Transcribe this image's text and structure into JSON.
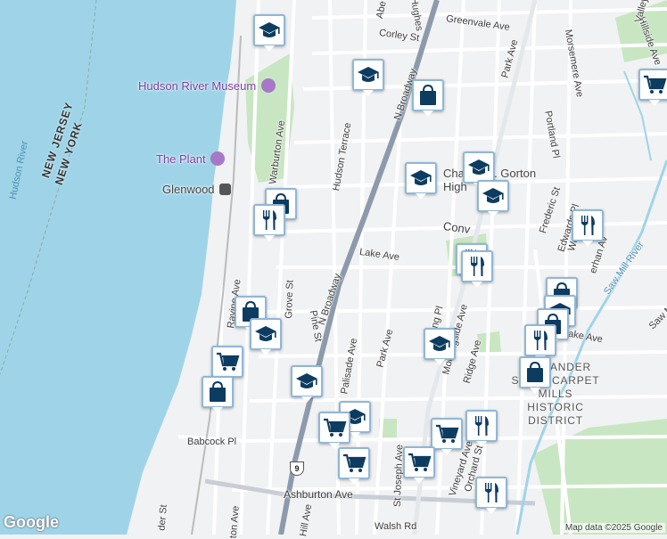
{
  "map": {
    "street_labels": [
      {
        "id": "greenvale-ave",
        "text": "Greenvale Ave"
      },
      {
        "id": "corley-st",
        "text": "Corley St"
      },
      {
        "id": "hughes",
        "text": "Hughes"
      },
      {
        "id": "n-broadway-top",
        "text": "N Broadway"
      },
      {
        "id": "n-broadway-mid",
        "text": "N Broadway"
      },
      {
        "id": "park-ave-top",
        "text": "Park Ave"
      },
      {
        "id": "park-ave-bottom",
        "text": "Park Ave"
      },
      {
        "id": "morsemere-ave",
        "text": "Morsemere Ave"
      },
      {
        "id": "portland-pl",
        "text": "Portland Pl"
      },
      {
        "id": "hudson-terrace",
        "text": "Hudson Terrace"
      },
      {
        "id": "warburton-ave",
        "text": "Warburton Ave"
      },
      {
        "id": "frederic-st",
        "text": "Frederic St"
      },
      {
        "id": "edwards-pl",
        "text": "Edwards Pl"
      },
      {
        "id": "lake-ave",
        "text": "Lake Ave"
      },
      {
        "id": "lake-ave-east",
        "text": "ake Ave"
      },
      {
        "id": "convent",
        "text": "Conv"
      },
      {
        "id": "saw-mill-river",
        "text": "Saw Mill River"
      },
      {
        "id": "saw-m",
        "text": "Saw M"
      },
      {
        "id": "grove-st",
        "text": "Grove St"
      },
      {
        "id": "ravine-ave",
        "text": "Ravine Ave"
      },
      {
        "id": "pine-st",
        "text": "Pine St"
      },
      {
        "id": "palisade-ave",
        "text": "Palisade Ave"
      },
      {
        "id": "ridge-ave",
        "text": "Ridge Ave"
      },
      {
        "id": "morningside-ave",
        "text": "Morningside Ave"
      },
      {
        "id": "ng-pl",
        "text": "ng Pl"
      },
      {
        "id": "babcock-pl",
        "text": "Babcock Pl"
      },
      {
        "id": "st-joseph-ave",
        "text": "St Joseph Ave"
      },
      {
        "id": "vineyard-ave",
        "text": "Vineyard Ave"
      },
      {
        "id": "orchard-st",
        "text": "Orchard St"
      },
      {
        "id": "ashburton-ave",
        "text": "Ashburton Ave"
      },
      {
        "id": "walsh-rd",
        "text": "Walsh Rd"
      },
      {
        "id": "hill-ave",
        "text": "Hill Ave"
      },
      {
        "id": "der-st",
        "text": "der St"
      },
      {
        "id": "ton-ave",
        "text": "ton Ave"
      },
      {
        "id": "hillside-ave",
        "text": "Hillside Ave"
      },
      {
        "id": "valley",
        "text": "Valley"
      },
      {
        "id": "abe",
        "text": "Abe"
      },
      {
        "id": "erhan-av",
        "text": "erhan Av"
      },
      {
        "id": "wo",
        "text": "Wo"
      }
    ],
    "poi": {
      "hudson_river_museum": "Hudson River Museum",
      "the_plant": "The Plant",
      "glenwood": "Glenwood",
      "charles_e_gorton": "Charles E. Gorton",
      "high": "High"
    },
    "district": [
      "ALEXANDER",
      "SMITH CARPET",
      "MILLS HISTORIC",
      "DISTRICT"
    ],
    "water_label": "Hudson River",
    "state_labels": [
      "NEW JERSEY",
      "NEW YORK"
    ],
    "route_shield": "9",
    "google_logo": "Google",
    "attribution": "Map data ©2025 Google",
    "colors": {
      "water": "#9fd4e8",
      "park": "#c8e6c2",
      "road_major": "#8c9aab",
      "road_minor": "#ffffff",
      "marker_icon": "#0d3c61",
      "marker_border": "#8fb7d6"
    },
    "markers": [
      {
        "id": "school-1",
        "icon": "school-icon"
      },
      {
        "id": "school-2",
        "icon": "school-icon"
      },
      {
        "id": "shopping-1",
        "icon": "shopping-bag-icon"
      },
      {
        "id": "cart-1",
        "icon": "cart-icon"
      },
      {
        "id": "school-3",
        "icon": "school-icon"
      },
      {
        "id": "school-4",
        "icon": "school-icon"
      },
      {
        "id": "school-5",
        "icon": "school-icon"
      },
      {
        "id": "shopping-2",
        "icon": "shopping-bag-icon"
      },
      {
        "id": "restaurant-1",
        "icon": "restaurant-icon"
      },
      {
        "id": "restaurant-2",
        "icon": "restaurant-icon"
      },
      {
        "id": "restaurant-3",
        "icon": "restaurant-icon"
      },
      {
        "id": "restaurant-4",
        "icon": "restaurant-icon"
      },
      {
        "id": "shopping-3",
        "icon": "shopping-bag-icon"
      },
      {
        "id": "school-6",
        "icon": "school-icon"
      },
      {
        "id": "shopping-4",
        "icon": "shopping-bag-icon"
      },
      {
        "id": "shopping-5",
        "icon": "shopping-bag-icon"
      },
      {
        "id": "restaurant-5",
        "icon": "restaurant-icon"
      },
      {
        "id": "shopping-6",
        "icon": "shopping-bag-icon"
      },
      {
        "id": "cart-2",
        "icon": "cart-icon"
      },
      {
        "id": "shopping-7",
        "icon": "shopping-bag-icon"
      },
      {
        "id": "school-7",
        "icon": "school-icon"
      },
      {
        "id": "school-8",
        "icon": "school-icon"
      },
      {
        "id": "school-9",
        "icon": "school-icon"
      },
      {
        "id": "school-10",
        "icon": "school-icon"
      },
      {
        "id": "cart-3",
        "icon": "cart-icon"
      },
      {
        "id": "restaurant-6",
        "icon": "restaurant-icon"
      },
      {
        "id": "cart-4",
        "icon": "cart-icon"
      },
      {
        "id": "cart-5",
        "icon": "cart-icon"
      },
      {
        "id": "cart-6",
        "icon": "cart-icon"
      },
      {
        "id": "restaurant-7",
        "icon": "restaurant-icon"
      }
    ]
  }
}
